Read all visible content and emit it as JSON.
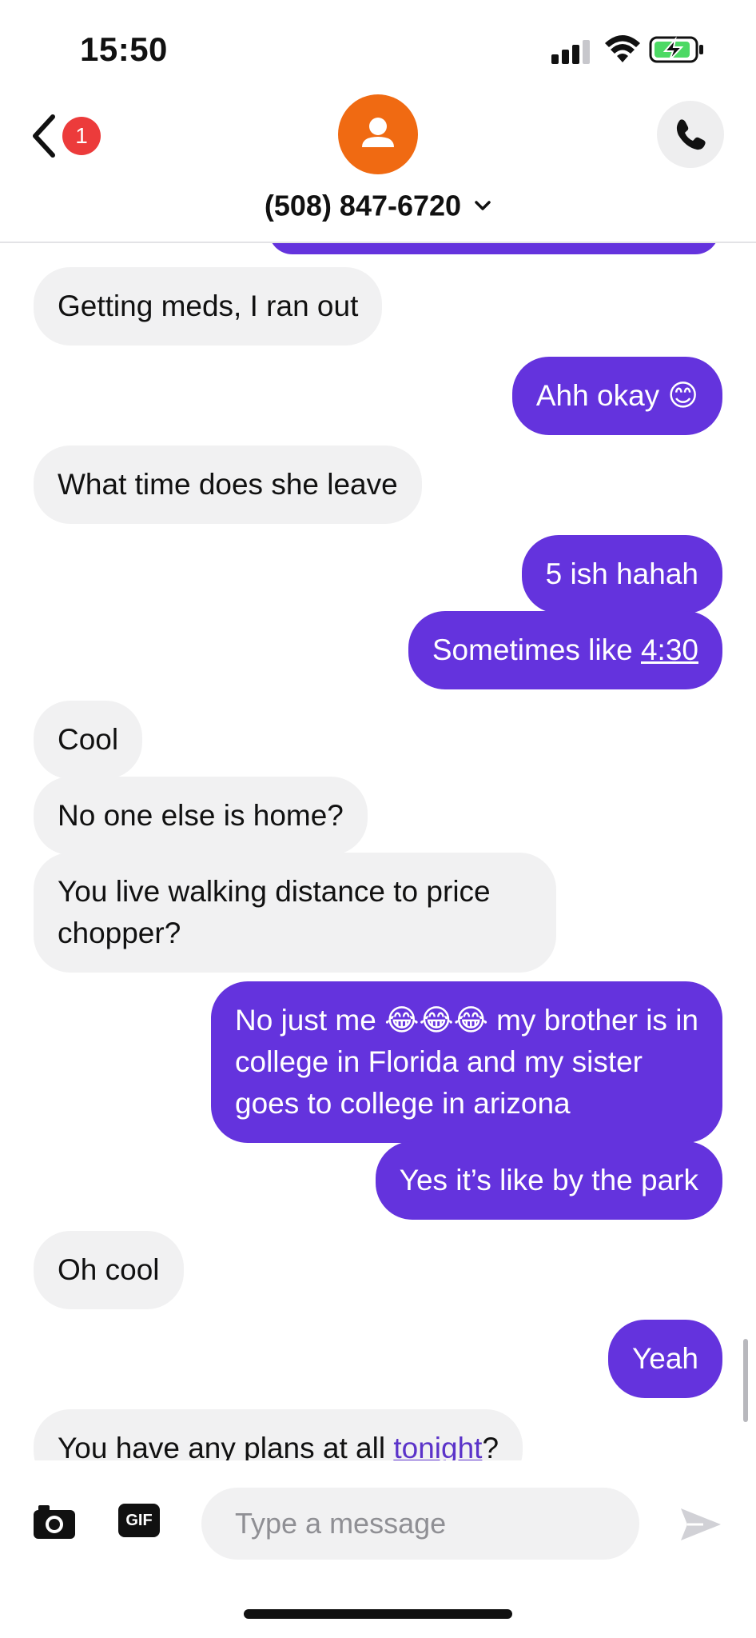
{
  "status_bar": {
    "time": "15:50"
  },
  "header": {
    "back_badge": "1",
    "contact_name": "(508) 847-6720"
  },
  "messages": [
    {
      "side": "in",
      "text": "Getting meds, I ran out"
    },
    {
      "side": "out",
      "text": "Ahh okay 😊"
    },
    {
      "side": "in",
      "text": "What time does she leave"
    },
    {
      "side": "out",
      "text": "5 ish hahah"
    },
    {
      "side": "out",
      "text_prefix": "Sometimes like ",
      "text_link": "4:30"
    },
    {
      "side": "in",
      "text": "Cool"
    },
    {
      "side": "in",
      "text": "No one else is home?"
    },
    {
      "side": "in",
      "text": "You live walking distance to price chopper?"
    },
    {
      "side": "out",
      "text": "No just me 😂😂😂 my brother is in college in Florida and my sister goes to college in arizona"
    },
    {
      "side": "out",
      "text": "Yes it’s like by the park"
    },
    {
      "side": "in",
      "text": "Oh cool"
    },
    {
      "side": "out",
      "text": "Yeah"
    },
    {
      "side": "in",
      "text_prefix": "You have any plans at all ",
      "text_link": "tonight",
      "text_suffix": "?"
    }
  ],
  "composer": {
    "gif_label": "GIF",
    "placeholder": "Type a message"
  },
  "colors": {
    "outgoing_bubble": "#6433dd",
    "incoming_bubble": "#f1f1f2",
    "avatar": "#f06a12",
    "badge": "#ec3b3b",
    "battery_charge": "#4cd964"
  },
  "icons": [
    "back-chevron-icon",
    "avatar-person-icon",
    "chevron-down-icon",
    "phone-icon",
    "camera-icon",
    "gif-icon",
    "send-icon",
    "signal-icon",
    "wifi-icon",
    "battery-charging-icon"
  ]
}
